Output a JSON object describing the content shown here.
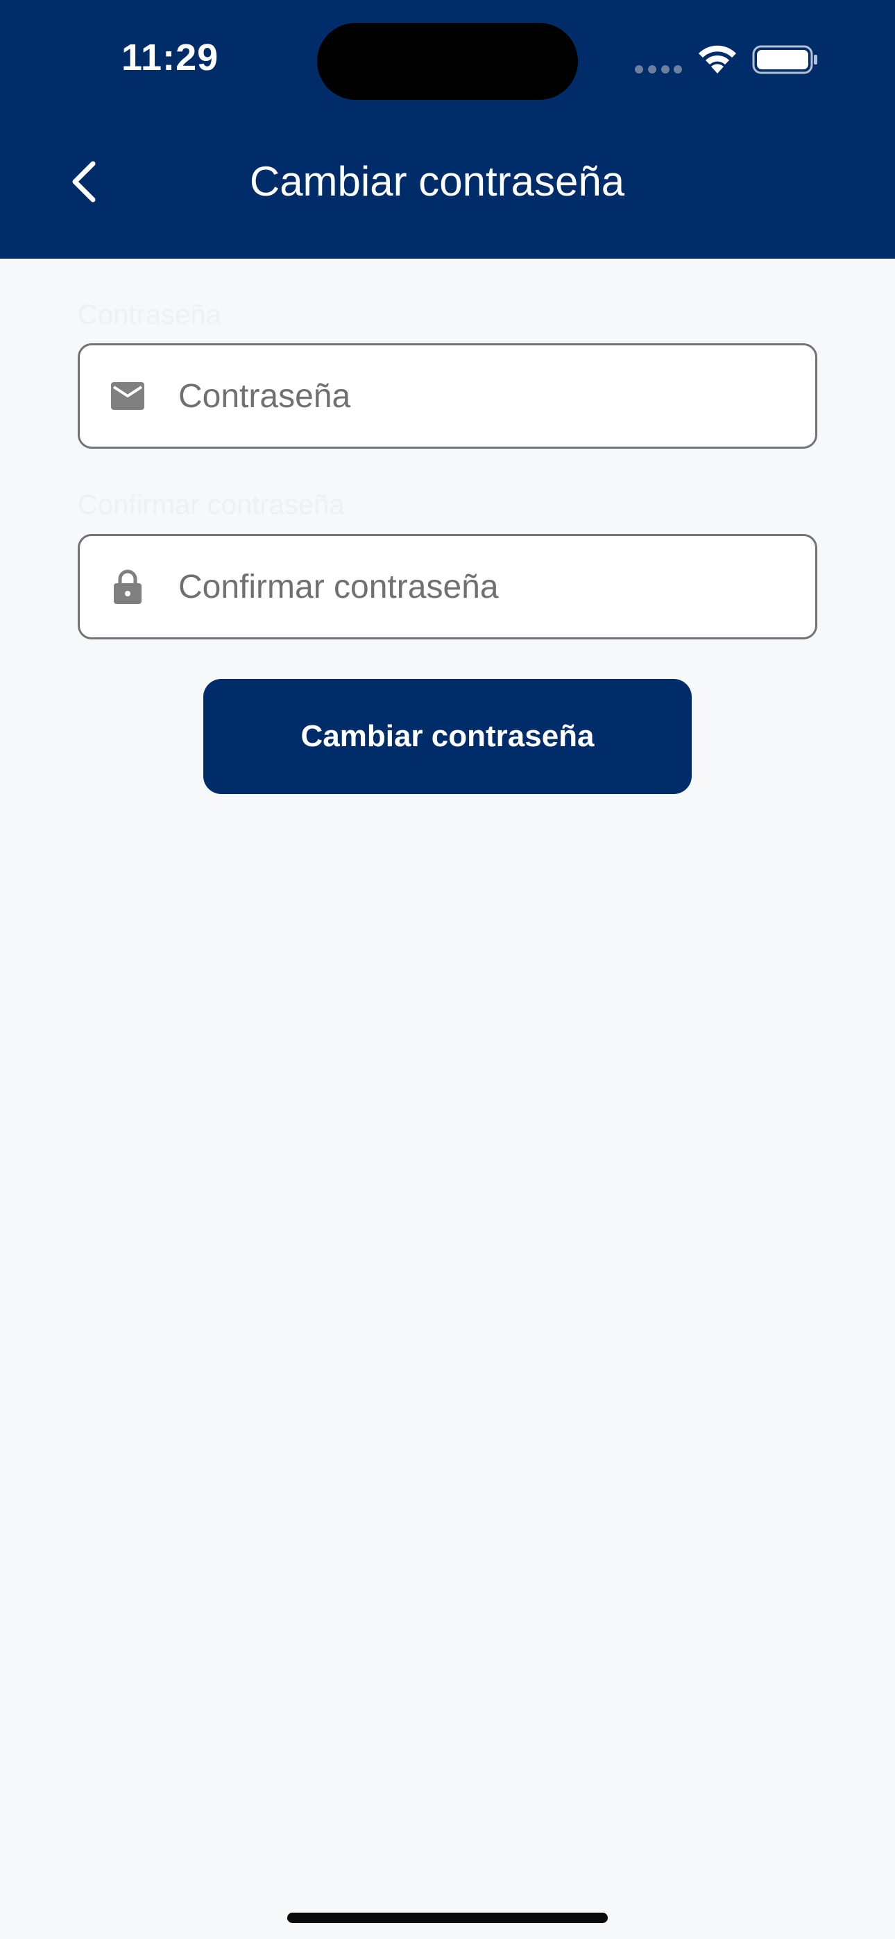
{
  "status_bar": {
    "time": "11:29"
  },
  "header": {
    "title": "Cambiar contraseña",
    "background_color": "#002d69",
    "back_icon": "chevron-left-icon"
  },
  "form": {
    "password": {
      "label": "Contraseña",
      "placeholder": "Contraseña",
      "value": "",
      "icon": "mail-icon"
    },
    "confirm_password": {
      "label": "Confirmar contraseña",
      "placeholder": "Confirmar contraseña",
      "value": "",
      "icon": "lock-icon"
    },
    "submit_label": "Cambiar contraseña",
    "button_color": "#002d69"
  }
}
